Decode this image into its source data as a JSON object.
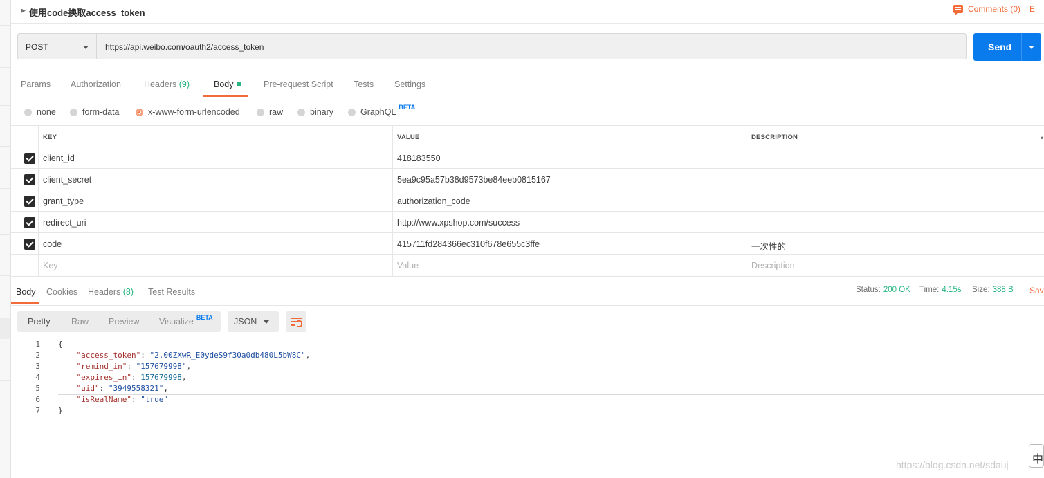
{
  "request": {
    "title": "使用code换取access_token",
    "comments": "Comments (0)",
    "comments_extra": "E",
    "method": "POST",
    "url": "https://api.weibo.com/oauth2/access_token",
    "send_label": "Send"
  },
  "request_tabs": {
    "params": "Params",
    "authorization": "Authorization",
    "headers": "Headers",
    "headers_count": "(9)",
    "body": "Body",
    "prerequest": "Pre-request Script",
    "tests": "Tests",
    "settings": "Settings"
  },
  "body_modes": {
    "none": "none",
    "form_data": "form-data",
    "urlencoded": "x-www-form-urlencoded",
    "raw": "raw",
    "binary": "binary",
    "graphql": "GraphQL",
    "beta": "BETA",
    "selected": "x-www-form-urlencoded"
  },
  "params_table": {
    "headers": [
      "KEY",
      "VALUE",
      "DESCRIPTION"
    ],
    "more": "•••",
    "rows": [
      {
        "key": "client_id",
        "value": "418183550",
        "description": ""
      },
      {
        "key": "client_secret",
        "value": "5ea9c95a57b38d9573be84eeb0815167",
        "description": ""
      },
      {
        "key": "grant_type",
        "value": "authorization_code",
        "description": ""
      },
      {
        "key": "redirect_uri",
        "value": "http://www.xpshop.com/success",
        "description": ""
      },
      {
        "key": "code",
        "value": "415711fd284366ec310f678e655c3ffe",
        "description": "一次性的"
      }
    ],
    "placeholder": {
      "key": "Key",
      "value": "Value",
      "description": "Description"
    }
  },
  "response_tabs": {
    "body": "Body",
    "cookies": "Cookies",
    "headers": "Headers",
    "headers_count": "(8)",
    "test_results": "Test Results"
  },
  "response_status": {
    "status_label": "Status:",
    "status_value": "200 OK",
    "time_label": "Time:",
    "time_value": "4.15s",
    "size_label": "Size:",
    "size_value": "388 B",
    "save": "Save"
  },
  "response_view": {
    "pretty": "Pretty",
    "raw": "Raw",
    "preview": "Preview",
    "visualize": "Visualize",
    "beta": "BETA",
    "format": "JSON"
  },
  "response_body": {
    "lines": [
      {
        "n": "1",
        "open": "{"
      },
      {
        "n": "2",
        "key": "\"access_token\"",
        "val": "\"2.00ZXwR_E0ydeS9f30a0db480L5bW8C\"",
        "type": "s",
        "end": ","
      },
      {
        "n": "3",
        "key": "\"remind_in\"",
        "val": "\"157679998\"",
        "type": "s",
        "end": ","
      },
      {
        "n": "4",
        "key": "\"expires_in\"",
        "val": "157679998",
        "type": "n",
        "end": ","
      },
      {
        "n": "5",
        "key": "\"uid\"",
        "val": "\"3949558321\"",
        "type": "s",
        "end": ","
      },
      {
        "n": "6",
        "key": "\"isRealName\"",
        "val": "\"true\"",
        "type": "s",
        "end": ""
      },
      {
        "n": "7",
        "open": "}"
      }
    ]
  },
  "footer": {
    "watermark": "https://blog.csdn.net/sdauj",
    "ime": "中"
  },
  "colors": {
    "accent": "#f26b3a",
    "send": "#097bed",
    "success": "#26b47f"
  },
  "icons": [
    "caret-right-icon",
    "comment-icon",
    "chevron-down-icon",
    "checkbox-icon",
    "wrap-lines-icon",
    "more-icon"
  ]
}
